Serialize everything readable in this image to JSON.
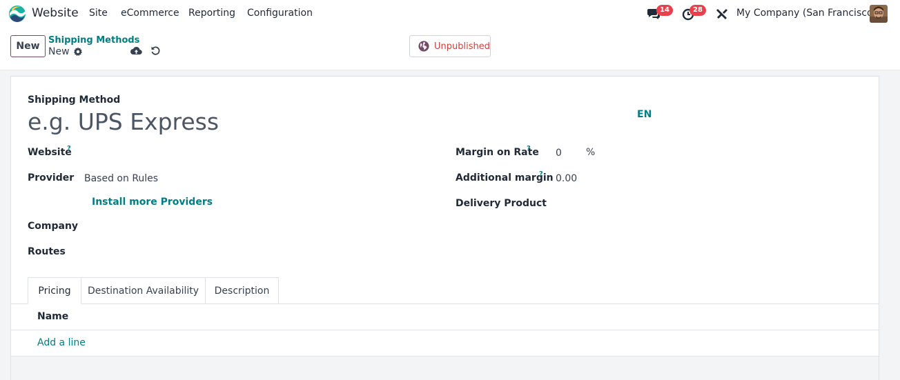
{
  "navbar": {
    "app_name": "Website",
    "menu": [
      "Site",
      "eCommerce",
      "Reporting",
      "Configuration"
    ],
    "messages_count": "14",
    "activities_count": "28",
    "company": "My Company (San Francisco)"
  },
  "control_panel": {
    "new_label": "New",
    "breadcrumb_parent": "Shipping Methods",
    "breadcrumb_current": "New",
    "status_button": "Unpublished"
  },
  "form": {
    "name_label": "Shipping Method",
    "name_placeholder": "e.g. UPS Express",
    "lang": "EN",
    "left": {
      "website_label": "Website",
      "help_mark": "?",
      "provider_label": "Provider",
      "provider_value": "Based on Rules",
      "install_link": "Install more Providers",
      "company_label": "Company",
      "routes_label": "Routes"
    },
    "right": {
      "margin_rate_label": "Margin on Rate",
      "margin_rate_value": "0",
      "margin_rate_unit": "%",
      "additional_margin_label": "Additional margin",
      "additional_margin_value": "0.00",
      "delivery_product_label": "Delivery Product"
    },
    "tabs": [
      "Pricing",
      "Destination Availability",
      "Description"
    ],
    "table": {
      "column_name": "Name",
      "add_line": "Add a line"
    }
  },
  "colors": {
    "brand": "#714b67",
    "link": "#017e84",
    "badge": "#e8414b",
    "unpublished": "#d23f3a"
  }
}
